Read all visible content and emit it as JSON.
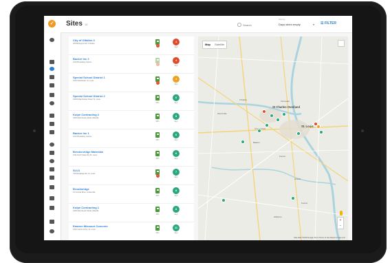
{
  "header": {
    "title": "Sites",
    "count": "16",
    "search_placeholder": "Search",
    "sort_label": "Sort by",
    "sort_value": "Days when empty",
    "filter_label": "FILTER"
  },
  "sites": [
    {
      "name": "City of Olfallon 3",
      "address": "265 Burlington Rd, O'Fallon",
      "dev_sub": "",
      "badge": "4",
      "badge_sub": "days",
      "badge_color": "#e14b2a",
      "alert": "!",
      "pale": false,
      "alert_pale": false
    },
    {
      "name": "Backer Inc 2",
      "address": "1212 Broadway, Festus",
      "dev_sub": "",
      "badge": "4",
      "badge_sub": "days",
      "badge_color": "#e14b2a",
      "alert": "!",
      "pale": true,
      "alert_pale": true
    },
    {
      "name": "Special School District 1",
      "address": "1010 Nola Road, St. Louis",
      "dev_sub": "",
      "badge": "4",
      "badge_sub": "days",
      "badge_color": "#f0a020",
      "alert": "!",
      "pale": false,
      "alert_pale": false
    },
    {
      "name": "Special School District 2",
      "address": "10400 Manchester Road, St. Louis",
      "dev_sub": "90%",
      "badge": "6",
      "badge_sub": "days",
      "badge_color": "#2aa87a",
      "alert": "",
      "pale": false,
      "alert_pale": false
    },
    {
      "name": "Kolpe Contracting 2",
      "address": "1900 Manchester Road, Ellisville",
      "dev_sub": "90%",
      "badge": "8",
      "badge_sub": "days",
      "badge_color": "#2aa87a",
      "alert": "",
      "pale": false,
      "alert_pale": false
    },
    {
      "name": "Backer Inc 1",
      "address": "1212 Broadway, Festus",
      "dev_sub": "90%",
      "badge": "6",
      "badge_sub": "days",
      "badge_color": "#2aa87a",
      "alert": "",
      "pale": false,
      "alert_pale": false
    },
    {
      "name": "Breckenridge Materials",
      "address": "1011 North State Rd, St. Louis",
      "dev_sub": "90%",
      "badge": "6",
      "badge_sub": "days",
      "badge_color": "#2aa87a",
      "alert": "",
      "pale": false,
      "alert_pale": false
    },
    {
      "name": "SLU1",
      "address": "734 Broadway Rd, St. Louis",
      "dev_sub": "",
      "badge": "7",
      "badge_sub": "days",
      "badge_color": "#2aa87a",
      "alert": "!",
      "pale": false,
      "alert_pale": false
    },
    {
      "name": "Brookbridge",
      "address": "12 Central Drive, Lindenville",
      "dev_sub": "90%",
      "badge": "8",
      "badge_sub": "days",
      "badge_color": "#2aa87a",
      "alert": "",
      "pale": false,
      "alert_pale": false
    },
    {
      "name": "Kolpe Contracting 1",
      "address": "1900 Manchester Road, Ellisville",
      "dev_sub": "90%",
      "badge": "8",
      "badge_sub": "days",
      "badge_color": "#2aa87a",
      "alert": "",
      "pale": false,
      "alert_pale": false
    },
    {
      "name": "Eastern Missouri Concrete",
      "address": "1010 Carrier Drive, St. Louis",
      "dev_sub": "90%",
      "badge": "11",
      "badge_sub": "days",
      "badge_color": "#2aa87a",
      "alert": "",
      "pale": false,
      "alert_pale": false
    }
  ],
  "map": {
    "toggle_map": "Map",
    "toggle_sat": "Satellite",
    "cities": [
      "St Charles Overland",
      "St. Louis",
      "Florissant",
      "Chesterfield",
      "Ballwin",
      "Fenton",
      "Arnold",
      "Festus",
      "Wentzville",
      "O'Fallon",
      "Hillsboro"
    ],
    "footer": "Map data ©2018 Google   10 km   Terms of Use   Report a map error",
    "zoom_in": "+",
    "zoom_out": "−"
  },
  "colors": {
    "accent": "#2d7fd4",
    "good": "#2aa87a",
    "warn": "#f0a020",
    "bad": "#e14b2a",
    "device_green": "#4a9a3a",
    "logo": "#f19a1f"
  },
  "rail_icons": [
    "logo-icon",
    "user-icon",
    "bar-chart-icon",
    "location-pin-icon",
    "device-icon",
    "tablet-icon",
    "document-icon",
    "alert-circle-icon",
    "calendar-icon",
    "calendar-list-icon",
    "calendar-check-icon",
    "pin-icon",
    "trash-icon",
    "help-icon",
    "stack-icon",
    "building-icon",
    "layers-icon",
    "truck-icon",
    "calendar-month-icon",
    "people-icon",
    "settings-icon"
  ]
}
